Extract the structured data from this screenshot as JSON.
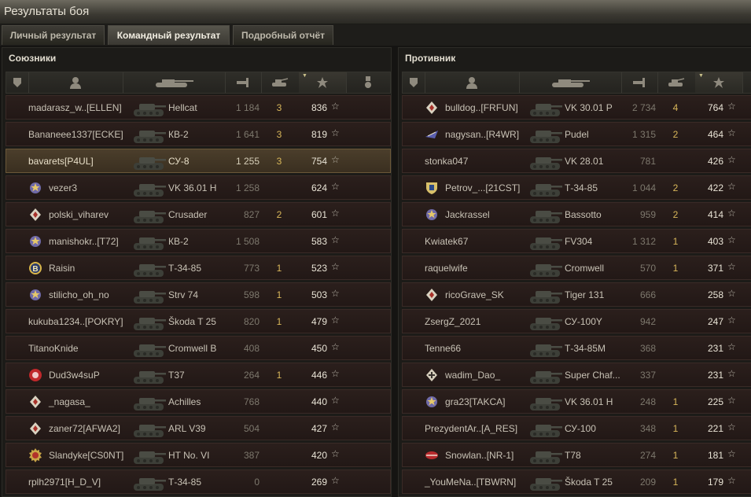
{
  "window": {
    "title": "Результаты боя"
  },
  "tabs": [
    {
      "label": "Личный результат",
      "active": false
    },
    {
      "label": "Командный результат",
      "active": true
    },
    {
      "label": "Подробный отчёт",
      "active": false
    }
  ],
  "allies": {
    "title": "Союзники",
    "rows": [
      {
        "player": "madarasz_w..[ELLEN]",
        "tank": "Hellcat",
        "damage": "1 184",
        "kills": "3",
        "xp": "836",
        "badge": ""
      },
      {
        "player": "Bananeee1337[ECKE]",
        "tank": "КВ-2",
        "damage": "1 641",
        "kills": "3",
        "xp": "819",
        "badge": ""
      },
      {
        "player": "bavarets[P4UL]",
        "tank": "СУ-8",
        "damage": "1 255",
        "kills": "3",
        "xp": "754",
        "badge": "",
        "highlight": true
      },
      {
        "player": "vezer3",
        "tank": "VK 36.01 H",
        "damage": "1 258",
        "kills": "",
        "xp": "624",
        "badge": "star-medal-icon"
      },
      {
        "player": "polski_viharev",
        "tank": "Crusader",
        "damage": "827",
        "kills": "2",
        "xp": "601",
        "badge": "diamond-icon"
      },
      {
        "player": "manishokr..[T72]",
        "tank": "КВ-2",
        "damage": "1 508",
        "kills": "",
        "xp": "583",
        "badge": "star-medal-icon"
      },
      {
        "player": "Raisin",
        "tank": "Т-34-85",
        "damage": "773",
        "kills": "1",
        "xp": "523",
        "badge": "b-coin-icon"
      },
      {
        "player": "stilicho_oh_no",
        "tank": "Strv 74",
        "damage": "598",
        "kills": "1",
        "xp": "503",
        "badge": "star-medal-icon"
      },
      {
        "player": "kukuba1234..[POKRY]",
        "tank": "Škoda T 25",
        "damage": "820",
        "kills": "1",
        "xp": "479",
        "badge": ""
      },
      {
        "player": "TitanoKnide",
        "tank": "Cromwell B",
        "damage": "408",
        "kills": "",
        "xp": "450",
        "badge": ""
      },
      {
        "player": "Dud3w4suP",
        "tank": "T37",
        "damage": "264",
        "kills": "1",
        "xp": "446",
        "badge": "red-emblem-icon"
      },
      {
        "player": "_nagasa_",
        "tank": "Achilles",
        "damage": "768",
        "kills": "",
        "xp": "440",
        "badge": "diamond-icon"
      },
      {
        "player": "zaner72[AFWA2]",
        "tank": "ARL V39",
        "damage": "504",
        "kills": "",
        "xp": "427",
        "badge": "diamond-icon"
      },
      {
        "player": "Slandyke[CS0NT]",
        "tank": "HT No. VI",
        "damage": "387",
        "kills": "",
        "xp": "420",
        "badge": "gear-emblem-icon"
      },
      {
        "player": "rplh2971[H_D_V]",
        "tank": "Т-34-85",
        "damage": "0",
        "kills": "",
        "xp": "269",
        "badge": ""
      }
    ]
  },
  "enemies": {
    "title": "Противник",
    "rows": [
      {
        "player": "bulldog..[FRFUN]",
        "tank": "VK 30.01 P",
        "damage": "2 734",
        "kills": "4",
        "xp": "764",
        "badge": "diamond-icon"
      },
      {
        "player": "nagysan..[R4WR]",
        "tank": "Pudel",
        "damage": "1 315",
        "kills": "2",
        "xp": "464",
        "badge": "blue-wing-icon"
      },
      {
        "player": "stonka047",
        "tank": "VK 28.01",
        "damage": "781",
        "kills": "",
        "xp": "426",
        "badge": ""
      },
      {
        "player": "Petrov_...[21CST]",
        "tank": "Т-34-85",
        "damage": "1 044",
        "kills": "2",
        "xp": "422",
        "badge": "shield-icon"
      },
      {
        "player": "Jackrassel",
        "tank": "Bassotto",
        "damage": "959",
        "kills": "2",
        "xp": "414",
        "badge": "star-medal-icon"
      },
      {
        "player": "Kwiatek67",
        "tank": "FV304",
        "damage": "1 312",
        "kills": "1",
        "xp": "403",
        "badge": ""
      },
      {
        "player": "raquelwife",
        "tank": "Cromwell",
        "damage": "570",
        "kills": "1",
        "xp": "371",
        "badge": ""
      },
      {
        "player": "ricoGrave_SK",
        "tank": "Tiger 131",
        "damage": "666",
        "kills": "",
        "xp": "258",
        "badge": "diamond-icon"
      },
      {
        "player": "ZsergZ_2021",
        "tank": "СУ-100Y",
        "damage": "942",
        "kills": "",
        "xp": "247",
        "badge": ""
      },
      {
        "player": "Tenne66",
        "tank": "Т-34-85M",
        "damage": "368",
        "kills": "",
        "xp": "231",
        "badge": ""
      },
      {
        "player": "wadim_Dao_",
        "tank": "Super Chaf...",
        "damage": "337",
        "kills": "",
        "xp": "231",
        "badge": "cross-diamond-icon"
      },
      {
        "player": "gra23[TAKCA]",
        "tank": "VK 36.01 H",
        "damage": "248",
        "kills": "1",
        "xp": "225",
        "badge": "star-medal-icon"
      },
      {
        "player": "PrezydentAr..[A_RES]",
        "tank": "СУ-100",
        "damage": "348",
        "kills": "1",
        "xp": "221",
        "badge": ""
      },
      {
        "player": "Snowlan..[NR-1]",
        "tank": "T78",
        "damage": "274",
        "kills": "1",
        "xp": "181",
        "badge": "red-wing-icon"
      },
      {
        "player": "_YouMeNa..[TBWRN]",
        "tank": "Škoda T 25",
        "damage": "209",
        "kills": "1",
        "xp": "179",
        "badge": ""
      }
    ]
  },
  "star_glyph": "☆"
}
